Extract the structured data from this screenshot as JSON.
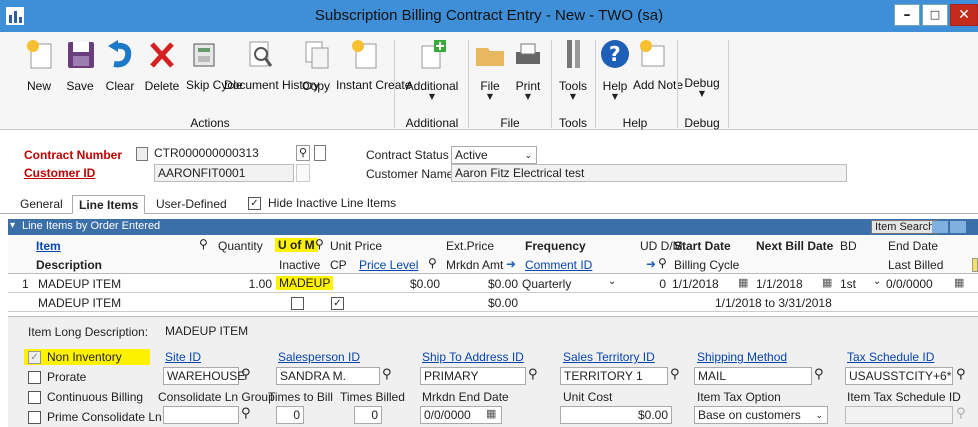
{
  "window": {
    "title": "Subscription Billing Contract Entry - New  -  TWO (sa)"
  },
  "ribbon": {
    "buttons": [
      {
        "label": "New",
        "icon": "new-icon"
      },
      {
        "label": "Save",
        "icon": "save-icon"
      },
      {
        "label": "Clear",
        "icon": "clear-icon"
      },
      {
        "label": "Delete",
        "icon": "delete-icon"
      },
      {
        "label": "Skip Cycle",
        "icon": "skip-cycle-icon"
      },
      {
        "label": "Document History",
        "icon": "document-history-icon"
      },
      {
        "label": "Copy",
        "icon": "copy-icon"
      },
      {
        "label": "Instant Create",
        "icon": "instant-create-icon"
      },
      {
        "label": "Additional",
        "icon": "additional-icon"
      },
      {
        "label": "File",
        "icon": "file-icon"
      },
      {
        "label": "Print",
        "icon": "print-icon"
      },
      {
        "label": "Tools",
        "icon": "tools-icon"
      },
      {
        "label": "Help",
        "icon": "help-icon"
      },
      {
        "label": "Add Note",
        "icon": "add-note-icon"
      },
      {
        "label": "Debug",
        "icon": "debug-icon"
      }
    ],
    "groups": {
      "actions": "Actions",
      "additional": "Additional",
      "file": "File",
      "tools": "Tools",
      "help": "Help",
      "debug": "Debug"
    }
  },
  "header": {
    "contract_number_label": "Contract Number",
    "contract_number": "CTR000000000313",
    "customer_id_label": "Customer ID",
    "customer_id": "AARONFIT0001",
    "contract_status_label": "Contract Status",
    "contract_status": "Active",
    "customer_name_label": "Customer Name",
    "customer_name": "Aaron Fitz Electrical test"
  },
  "tabs": [
    "General",
    "Line Items",
    "User-Defined"
  ],
  "hide_inactive_label": "Hide Inactive Line Items",
  "grid": {
    "bar_title": "Line Items by Order Entered",
    "item_search": "Item Search",
    "h1": {
      "item": "Item",
      "quantity": "Quantity",
      "uofm": "U of M",
      "unit_price": "Unit Price",
      "ext_price": "Ext.Price",
      "frequency": "Frequency",
      "ud_dm": "UD D/M",
      "start_date": "Start Date",
      "next_bill_date": "Next Bill Date",
      "bd": "BD",
      "end_date": "End Date"
    },
    "h2": {
      "description": "Description",
      "inactive": "Inactive",
      "cp": "CP",
      "price_level": "Price Level",
      "mrkdn_amt": "Mrkdn Amt",
      "comment_id": "Comment ID",
      "billing_cycle": "Billing Cycle",
      "last_billed": "Last Billed"
    },
    "row1": {
      "num": "1",
      "item": "MADEUP ITEM",
      "quantity": "1.00",
      "uofm": "MADEUP",
      "unit_price": "$0.00",
      "ext_price": "$0.00",
      "frequency": "Quarterly",
      "ud": "0",
      "start_date": "1/1/2018",
      "next_bill_date": "1/1/2018",
      "bd": "1st",
      "end_date": "0/0/0000"
    },
    "row2": {
      "description": "MADEUP ITEM",
      "mrkdn_amt": "$0.00",
      "billing_cycle": "1/1/2018 to 3/31/2018"
    }
  },
  "detail": {
    "long_desc_label": "Item Long Description:",
    "long_desc": "MADEUP ITEM",
    "non_inventory": "Non Inventory",
    "prorate": "Prorate",
    "continuous_billing": "Continuous Billing",
    "prime_consolidate": "Prime Consolidate Ln",
    "site_id_label": "Site ID",
    "site_id": "WAREHOUSE",
    "salesperson_label": "Salesperson ID",
    "salesperson": "SANDRA M.",
    "ship_to_label": "Ship To Address ID",
    "ship_to": "PRIMARY",
    "territory_label": "Sales Territory ID",
    "territory": "TERRITORY 1",
    "shipping_label": "Shipping Method",
    "shipping": "MAIL",
    "tax_schedule_label": "Tax Schedule ID",
    "tax_schedule": "USAUSSTCITY+6*",
    "consolidate_label": "Consolidate Ln Group",
    "times_to_bill_label": "Times to Bill",
    "times_to_bill": "0",
    "times_billed_label": "Times Billed",
    "times_billed": "0",
    "mrkdn_end_label": "Mrkdn End Date",
    "mrkdn_end": "0/0/0000",
    "unit_cost_label": "Unit Cost",
    "unit_cost": "$0.00",
    "item_tax_label": "Item Tax Option",
    "item_tax": "Base on customers",
    "item_tax_schedule_label": "Item Tax Schedule ID"
  }
}
